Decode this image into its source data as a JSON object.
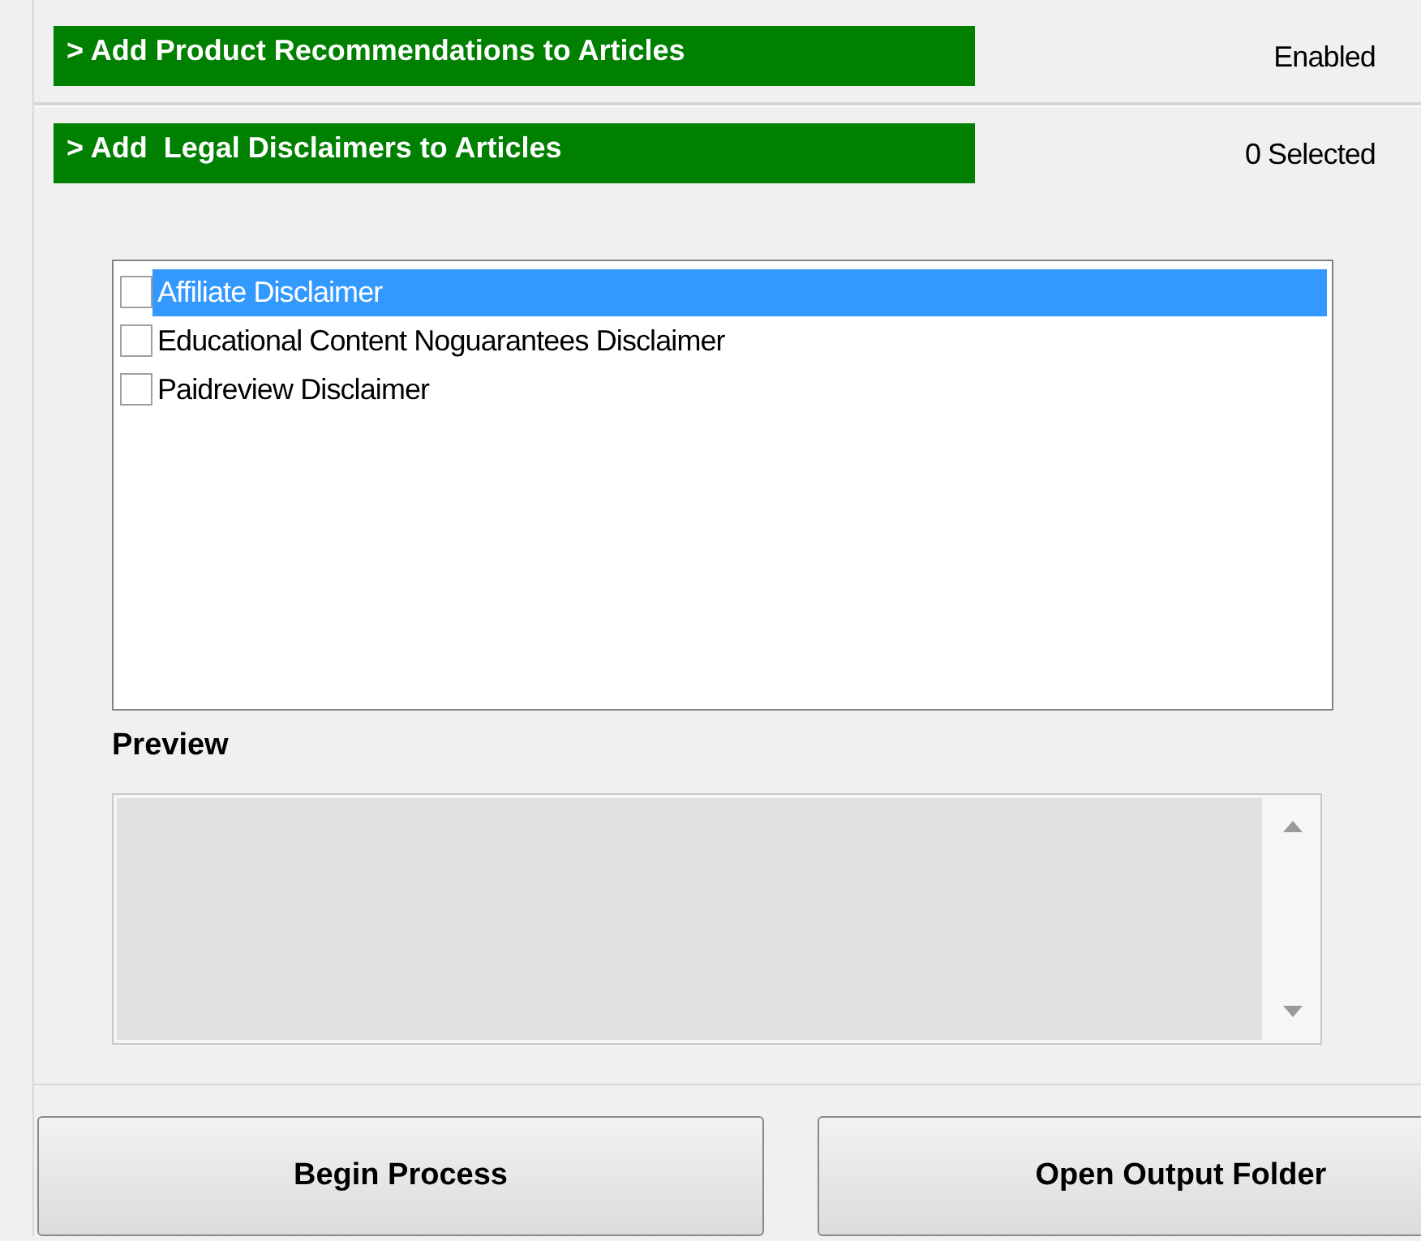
{
  "sections": [
    {
      "header": "> Add Product Recommendations to Articles",
      "status": "Enabled"
    },
    {
      "header": "> Add  Legal Disclaimers to Articles",
      "status": "0 Selected"
    }
  ],
  "disclaimers": [
    {
      "label": "Affiliate Disclaimer",
      "checked": false,
      "selected": true
    },
    {
      "label": "Educational Content Noguarantees Disclaimer",
      "checked": false,
      "selected": false
    },
    {
      "label": "Paidreview Disclaimer",
      "checked": false,
      "selected": false
    }
  ],
  "preview": {
    "label": "Preview"
  },
  "buttons": [
    "Begin Process",
    "Open Output Folder"
  ]
}
